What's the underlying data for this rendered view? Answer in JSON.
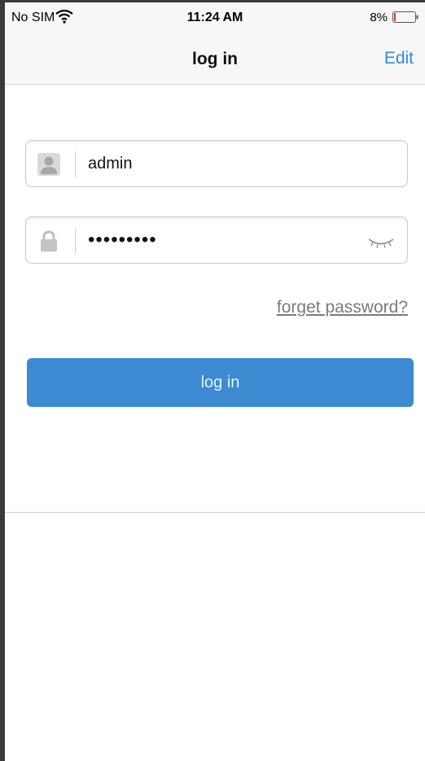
{
  "status_bar": {
    "carrier": "No SIM",
    "wifi_icon": "wifi-icon",
    "time": "11:24 AM",
    "battery_percent": "8%",
    "battery_icon": "battery-low-icon",
    "battery_level": 0.08,
    "battery_color": "#e0352b"
  },
  "nav": {
    "title": "log in",
    "edit_label": "Edit"
  },
  "form": {
    "username": {
      "icon": "user-icon",
      "value": "admin"
    },
    "password": {
      "icon": "lock-icon",
      "value": "•••••••••",
      "toggle_icon": "eye-closed-icon"
    },
    "forget_label": "forget password?",
    "submit_label": "log in"
  },
  "colors": {
    "accent": "#2f8ad8",
    "button": "#3c8ad2"
  }
}
